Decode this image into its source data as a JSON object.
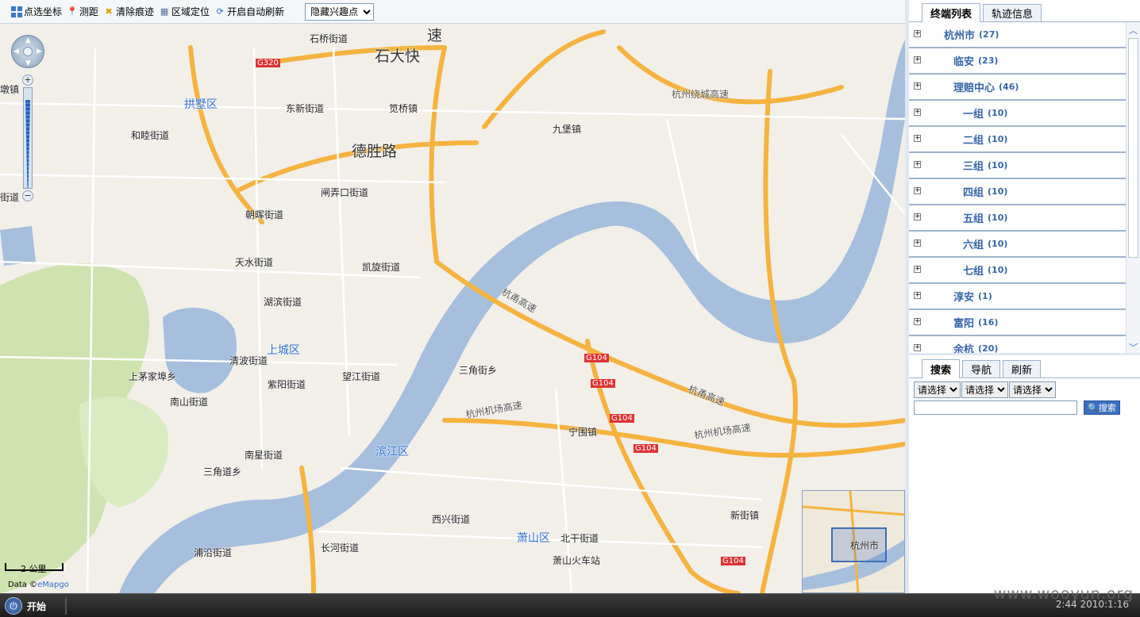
{
  "toolbar": {
    "tools": [
      {
        "label": "点选坐标",
        "icon": "grid-select-icon"
      },
      {
        "label": "测距",
        "icon": "map-pin-icon"
      },
      {
        "label": "清除痕迹",
        "icon": "eraser-icon"
      },
      {
        "label": "区域定位",
        "icon": "region-locate-icon"
      },
      {
        "label": "开启自动刷新",
        "icon": "refresh-icon"
      }
    ],
    "poi_select": {
      "selected": "隐藏兴趣点"
    }
  },
  "map": {
    "labels": {
      "shiqiao": "石桥街道",
      "shidaikuai": "石大快",
      "su": "速",
      "dunzhen": "墩镇",
      "gongshu": "拱墅区",
      "donxin": "东新街道",
      "jianqiao": "笕桥镇",
      "hesui": "和睦街道",
      "jiubao": "九堡镇",
      "deshenglu": "德胜路",
      "zhanongkou": "闸弄口街道",
      "jiedao_left": "街道",
      "chaohui": "朝晖街道",
      "tianshui": "天水街道",
      "kaixuan": "凯旋街道",
      "hubin": "湖滨街道",
      "shangcheng": "上城区",
      "qingbo": "清波街道",
      "wangjiang": "望江街道",
      "shangmao": "上茅家埠乡",
      "ziyang": "紫阳街道",
      "nanshan": "南山街道",
      "sanjiao": "三角街乡",
      "ningwei": "宁围镇",
      "nanxing": "南星街道",
      "sanjiaodao": "三角道乡",
      "binjiang": "滨江区",
      "xixing": "西兴街道",
      "xiaoshan": "萧山区",
      "beigan": "北干街道",
      "xinjie": "新街镇",
      "changhe": "长河街道",
      "puyan": "浦沿街道",
      "xiaoshanhuochezhan": "萧山火车站",
      "hangyong1": "杭甬高速",
      "hangyong2": "杭甬高速",
      "raocheng": "杭州绕城高速",
      "jichang1": "杭州机场高速",
      "jichang2": "杭州机场高速",
      "g104a": "G104",
      "g104b": "G104",
      "g104c": "G104",
      "g104d": "G104",
      "g104e": "G104",
      "g320": "G320"
    },
    "zoom_level_fraction": 0.88,
    "scale_label": "2 公里",
    "data_credit_prefix": "Data ©",
    "data_credit_brand": "eMapgo",
    "overview_label": "杭州市",
    "colors": {
      "water": "#a5bfdd",
      "land": "#f2efe9",
      "highway": "#f5b33f",
      "road": "#ffffff",
      "green": "#cfe3b0"
    }
  },
  "right_panel": {
    "top_tabs": [
      "终端列表",
      "轨迹信息"
    ],
    "tree": [
      {
        "name": "杭州市",
        "count": "(27)",
        "indent": 0
      },
      {
        "name": "临安",
        "count": "(23)",
        "indent": 1
      },
      {
        "name": "理赔中心",
        "count": "(46)",
        "indent": 1
      },
      {
        "name": "一组",
        "count": "(10)",
        "indent": 2
      },
      {
        "name": "二组",
        "count": "(10)",
        "indent": 2
      },
      {
        "name": "三组",
        "count": "(10)",
        "indent": 2
      },
      {
        "name": "四组",
        "count": "(10)",
        "indent": 2
      },
      {
        "name": "五组",
        "count": "(10)",
        "indent": 2
      },
      {
        "name": "六组",
        "count": "(10)",
        "indent": 2
      },
      {
        "name": "七组",
        "count": "(10)",
        "indent": 2
      },
      {
        "name": "淳安",
        "count": "(1)",
        "indent": 1
      },
      {
        "name": "富阳",
        "count": "(16)",
        "indent": 1
      },
      {
        "name": "余杭",
        "count": "(20)",
        "indent": 1
      }
    ],
    "bottom_tabs": [
      "搜索",
      "导航",
      "刷新"
    ],
    "filter_selects": [
      "请选择",
      "请选择",
      "请选择"
    ],
    "search_input_value": "",
    "search_button_label": "搜索"
  },
  "taskbar": {
    "start_label": "开始",
    "clock": "2:44 2010:1:16"
  },
  "watermark": "www.wooyun.org"
}
